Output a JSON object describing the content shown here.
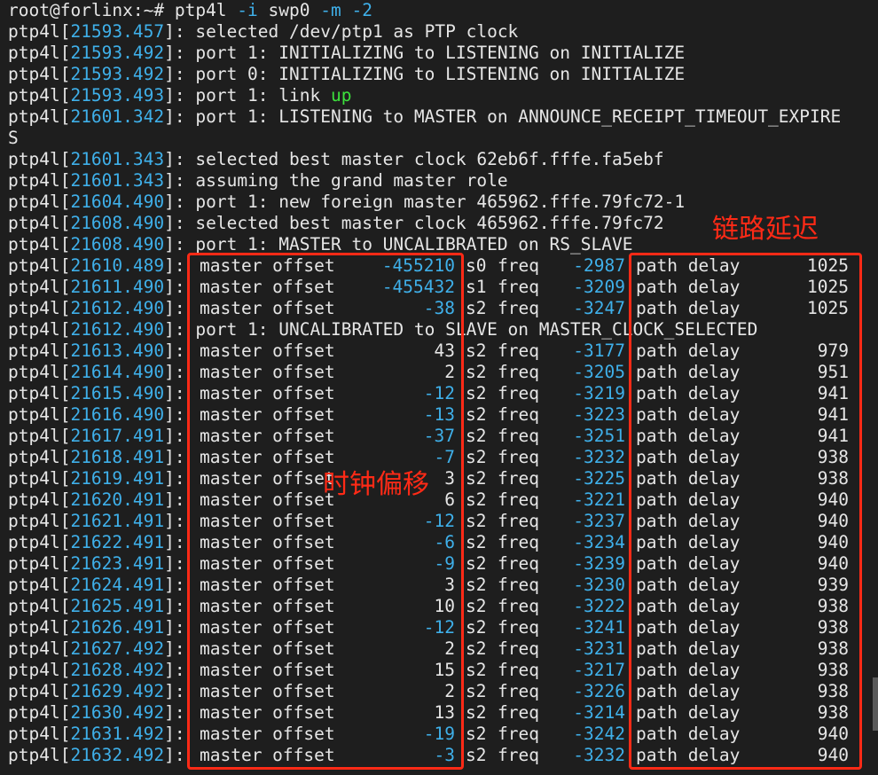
{
  "prompt": {
    "user_host": "root@forlinx:~# ",
    "cmd": "ptp4l",
    "args": [
      {
        "text": " -i",
        "color": "blue"
      },
      {
        "text": " swp0",
        "color": "normal"
      },
      {
        "text": " -m",
        "color": "blue"
      },
      {
        "text": " -2",
        "color": "blue"
      }
    ]
  },
  "messages": [
    {
      "ts": "21593.457",
      "parts": [
        {
          "text": "selected /dev/ptp1 as PTP clock"
        }
      ]
    },
    {
      "ts": "21593.492",
      "parts": [
        {
          "text": "port 1: INITIALIZING to LISTENING on INITIALIZE"
        }
      ]
    },
    {
      "ts": "21593.492",
      "parts": [
        {
          "text": "port 0: INITIALIZING to LISTENING on INITIALIZE"
        }
      ]
    },
    {
      "ts": "21593.493",
      "parts": [
        {
          "text": "port 1: link "
        },
        {
          "text": "up",
          "color": "green"
        }
      ]
    },
    {
      "ts": "21601.342",
      "parts": [
        {
          "text": "port 1: LISTENING to MASTER on ANNOUNCE_RECEIPT_TIMEOUT_EXPIRE"
        }
      ],
      "wrap": "S"
    },
    {
      "ts": "21601.343",
      "parts": [
        {
          "text": "selected best master clock 62eb6f.fffe.fa5ebf"
        }
      ]
    },
    {
      "ts": "21601.343",
      "parts": [
        {
          "text": "assuming the grand master role"
        }
      ]
    },
    {
      "ts": "21604.490",
      "parts": [
        {
          "text": "port 1: new foreign master 465962.fffe.79fc72-1"
        }
      ]
    },
    {
      "ts": "21608.490",
      "parts": [
        {
          "text": "selected best master clock 465962.fffe.79fc72"
        }
      ]
    },
    {
      "ts": "21608.490",
      "parts": [
        {
          "text": "port 1: MASTER to UNCALIBRATED on RS_SLAVE"
        }
      ]
    }
  ],
  "labels": {
    "prefix": "ptp4l",
    "offset": "master offset",
    "freq": "freq",
    "path": "path delay"
  },
  "stats_a": [
    {
      "ts": "21610.489",
      "offset": "-455210",
      "state": "s0",
      "freq": "-2987",
      "delay": "1025"
    },
    {
      "ts": "21611.490",
      "offset": "-455432",
      "state": "s1",
      "freq": "-3209",
      "delay": "1025"
    },
    {
      "ts": "21612.490",
      "offset": "-38",
      "state": "s2",
      "freq": "-3247",
      "delay": "1025"
    }
  ],
  "transition": {
    "ts": "21612.490",
    "text": "port 1: UNCALIBRATED to SLAVE on MASTER_CLOCK_SELECTED"
  },
  "stats_b": [
    {
      "ts": "21613.490",
      "offset": "43",
      "state": "s2",
      "freq": "-3177",
      "delay": "979"
    },
    {
      "ts": "21614.490",
      "offset": "2",
      "state": "s2",
      "freq": "-3205",
      "delay": "951"
    },
    {
      "ts": "21615.490",
      "offset": "-12",
      "state": "s2",
      "freq": "-3219",
      "delay": "941"
    },
    {
      "ts": "21616.490",
      "offset": "-13",
      "state": "s2",
      "freq": "-3223",
      "delay": "941"
    },
    {
      "ts": "21617.491",
      "offset": "-37",
      "state": "s2",
      "freq": "-3251",
      "delay": "941"
    },
    {
      "ts": "21618.491",
      "offset": "-7",
      "state": "s2",
      "freq": "-3232",
      "delay": "938"
    },
    {
      "ts": "21619.491",
      "offset": "3",
      "state": "s2",
      "freq": "-3225",
      "delay": "938"
    },
    {
      "ts": "21620.491",
      "offset": "6",
      "state": "s2",
      "freq": "-3221",
      "delay": "940"
    },
    {
      "ts": "21621.491",
      "offset": "-12",
      "state": "s2",
      "freq": "-3237",
      "delay": "940"
    },
    {
      "ts": "21622.491",
      "offset": "-6",
      "state": "s2",
      "freq": "-3234",
      "delay": "940"
    },
    {
      "ts": "21623.491",
      "offset": "-9",
      "state": "s2",
      "freq": "-3239",
      "delay": "940"
    },
    {
      "ts": "21624.491",
      "offset": "3",
      "state": "s2",
      "freq": "-3230",
      "delay": "939"
    },
    {
      "ts": "21625.491",
      "offset": "10",
      "state": "s2",
      "freq": "-3222",
      "delay": "938"
    },
    {
      "ts": "21626.491",
      "offset": "-12",
      "state": "s2",
      "freq": "-3241",
      "delay": "938"
    },
    {
      "ts": "21627.492",
      "offset": "2",
      "state": "s2",
      "freq": "-3231",
      "delay": "938"
    },
    {
      "ts": "21628.492",
      "offset": "15",
      "state": "s2",
      "freq": "-3217",
      "delay": "938"
    },
    {
      "ts": "21629.492",
      "offset": "2",
      "state": "s2",
      "freq": "-3226",
      "delay": "938"
    },
    {
      "ts": "21630.492",
      "offset": "13",
      "state": "s2",
      "freq": "-3214",
      "delay": "938"
    },
    {
      "ts": "21631.492",
      "offset": "-19",
      "state": "s2",
      "freq": "-3242",
      "delay": "940"
    },
    {
      "ts": "21632.492",
      "offset": "-3",
      "state": "s2",
      "freq": "-3232",
      "delay": "940"
    }
  ],
  "annotations": {
    "path_delay_label": "链路延迟",
    "clock_offset_label": "时钟偏移"
  },
  "colors": {
    "background": "#1e1e1e",
    "text": "#e6e6e6",
    "timestamp": "#3fb0ea",
    "link_up": "#3ce03c",
    "annotation": "#ff2a16"
  }
}
